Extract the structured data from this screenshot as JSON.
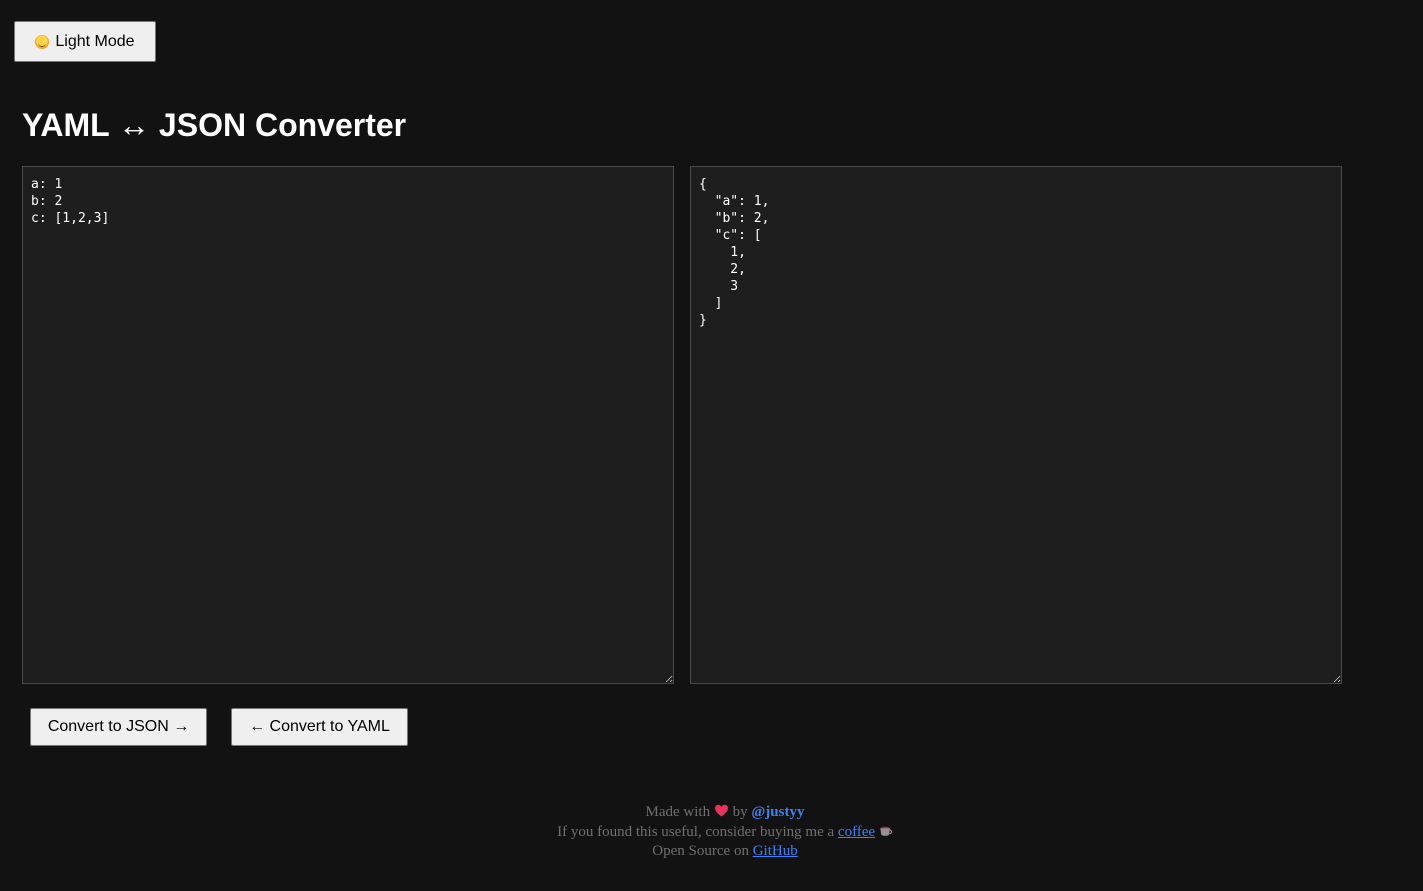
{
  "theme_toggle": {
    "label": "Light Mode",
    "icon": "sun-face-icon"
  },
  "title": "YAML ↔ JSON Converter",
  "yaml_input": {
    "value": "a: 1\nb: 2\nc: [1,2,3]"
  },
  "json_output": {
    "value": "{\n  \"a\": 1,\n  \"b\": 2,\n  \"c\": [\n    1,\n    2,\n    3\n  ]\n}"
  },
  "actions": {
    "to_json_label": "Convert to JSON →",
    "to_yaml_label": "← Convert to YAML"
  },
  "footer": {
    "made_with": "Made with",
    "by": "by",
    "author": "@justyy",
    "coffee_text": "If you found this useful, consider buying me a",
    "coffee_link": "coffee",
    "open_source": "Open Source on",
    "github_link": "GitHub"
  },
  "colors": {
    "background": "#121212",
    "editor_bg": "#1e1e1e",
    "link": "#3b82f6",
    "heart": "#e8325a"
  }
}
